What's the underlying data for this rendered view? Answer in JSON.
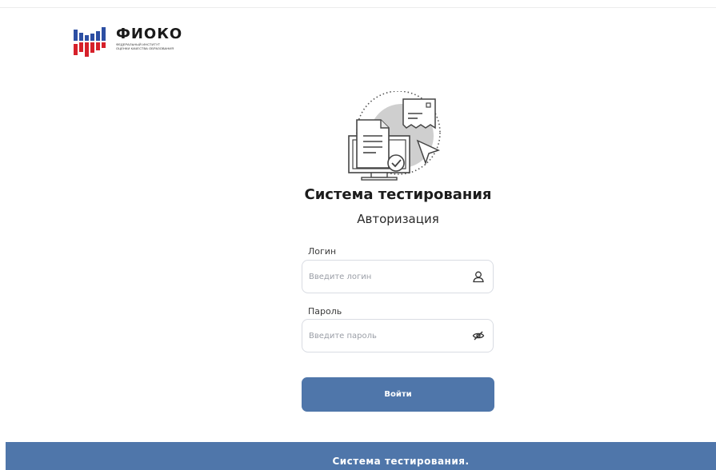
{
  "brand": {
    "name": "ФИОКО",
    "subtitle_line1": "Федеральный институт",
    "subtitle_line2": "оценки качества образования",
    "colors": {
      "blue": "#2d4fa3",
      "red": "#d6202a",
      "white": "#ffffff"
    }
  },
  "header": {
    "title": "Система тестирования",
    "subtitle": "Авторизация"
  },
  "form": {
    "login": {
      "label": "Логин",
      "placeholder": "Введите логин",
      "value": "",
      "icon": "user-icon"
    },
    "password": {
      "label": "Пароль",
      "placeholder": "Введите пароль",
      "value": "",
      "icon": "eye-slash-icon"
    },
    "submit_label": "Войти"
  },
  "footer": {
    "text": "Система тестирования."
  },
  "colors": {
    "accent": "#4f76aa",
    "border": "#d9dce3",
    "text": "#1c1c1c"
  }
}
